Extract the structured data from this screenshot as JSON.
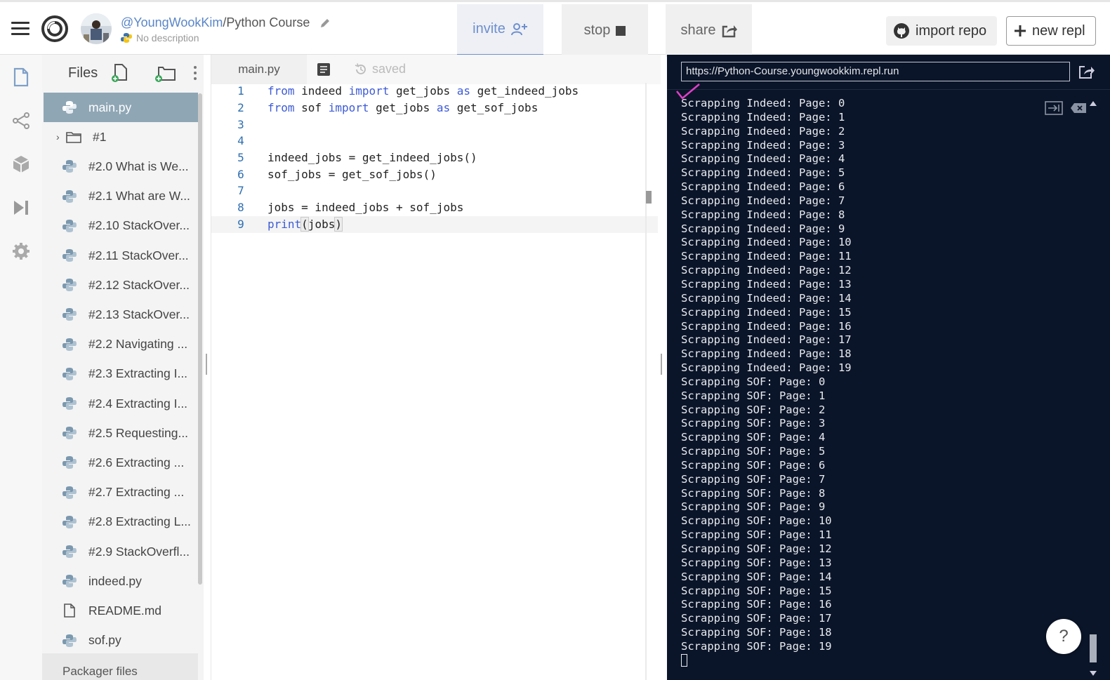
{
  "header": {
    "username": "@YoungWookKim",
    "separator": "/",
    "repl_name": "Python Course",
    "description": "No description",
    "invite_label": "invite",
    "stop_label": "stop",
    "share_label": "share",
    "import_label": "import repo",
    "new_repl_label": "new repl"
  },
  "files": {
    "title": "Files",
    "items": [
      {
        "label": "main.py",
        "type": "python",
        "active": true
      },
      {
        "label": "#1",
        "type": "folder"
      },
      {
        "label": "#2.0 What is We...",
        "type": "python"
      },
      {
        "label": "#2.1 What are W...",
        "type": "python"
      },
      {
        "label": "#2.10 StackOver...",
        "type": "python"
      },
      {
        "label": "#2.11 StackOver...",
        "type": "python"
      },
      {
        "label": "#2.12 StackOver...",
        "type": "python"
      },
      {
        "label": "#2.13 StackOver...",
        "type": "python"
      },
      {
        "label": "#2.2 Navigating ...",
        "type": "python"
      },
      {
        "label": "#2.3 Extracting I...",
        "type": "python"
      },
      {
        "label": "#2.4 Extracting I...",
        "type": "python"
      },
      {
        "label": "#2.5 Requesting...",
        "type": "python"
      },
      {
        "label": "#2.6 Extracting ...",
        "type": "python"
      },
      {
        "label": "#2.7 Extracting ...",
        "type": "python"
      },
      {
        "label": "#2.8 Extracting L...",
        "type": "python"
      },
      {
        "label": "#2.9 StackOverfl...",
        "type": "python"
      },
      {
        "label": "indeed.py",
        "type": "python"
      },
      {
        "label": "README.md",
        "type": "doc"
      },
      {
        "label": "sof.py",
        "type": "python"
      }
    ],
    "packager_label": "Packager files"
  },
  "editor": {
    "tab_label": "main.py",
    "saved_label": "saved",
    "lines": [
      {
        "n": "1",
        "tokens": [
          [
            "kw",
            "from"
          ],
          [
            "t",
            " indeed "
          ],
          [
            "kw",
            "import"
          ],
          [
            "t",
            " get_jobs "
          ],
          [
            "kw",
            "as"
          ],
          [
            "t",
            " get_indeed_jobs"
          ]
        ]
      },
      {
        "n": "2",
        "tokens": [
          [
            "kw",
            "from"
          ],
          [
            "t",
            " sof "
          ],
          [
            "kw",
            "import"
          ],
          [
            "t",
            " get_jobs "
          ],
          [
            "kw",
            "as"
          ],
          [
            "t",
            " get_sof_jobs"
          ]
        ]
      },
      {
        "n": "3",
        "tokens": []
      },
      {
        "n": "4",
        "tokens": []
      },
      {
        "n": "5",
        "tokens": [
          [
            "t",
            "indeed_jobs = get_indeed_jobs()"
          ]
        ]
      },
      {
        "n": "6",
        "tokens": [
          [
            "t",
            "sof_jobs = get_sof_jobs()"
          ]
        ]
      },
      {
        "n": "7",
        "tokens": []
      },
      {
        "n": "8",
        "tokens": [
          [
            "t",
            "jobs = indeed_jobs + sof_jobs"
          ]
        ]
      },
      {
        "n": "9",
        "tokens": [
          [
            "fn",
            "print"
          ],
          [
            "hl",
            "("
          ],
          [
            "t",
            "jobs"
          ],
          [
            "hl",
            ")"
          ]
        ],
        "current": true
      }
    ]
  },
  "console": {
    "url": "https://Python-Course.youngwookkim.repl.run",
    "output": [
      "Scrapping Indeed: Page: 0",
      "Scrapping Indeed: Page: 1",
      "Scrapping Indeed: Page: 2",
      "Scrapping Indeed: Page: 3",
      "Scrapping Indeed: Page: 4",
      "Scrapping Indeed: Page: 5",
      "Scrapping Indeed: Page: 6",
      "Scrapping Indeed: Page: 7",
      "Scrapping Indeed: Page: 8",
      "Scrapping Indeed: Page: 9",
      "Scrapping Indeed: Page: 10",
      "Scrapping Indeed: Page: 11",
      "Scrapping Indeed: Page: 12",
      "Scrapping Indeed: Page: 13",
      "Scrapping Indeed: Page: 14",
      "Scrapping Indeed: Page: 15",
      "Scrapping Indeed: Page: 16",
      "Scrapping Indeed: Page: 17",
      "Scrapping Indeed: Page: 18",
      "Scrapping Indeed: Page: 19",
      "Scrapping SOF: Page: 0",
      "Scrapping SOF: Page: 1",
      "Scrapping SOF: Page: 2",
      "Scrapping SOF: Page: 3",
      "Scrapping SOF: Page: 4",
      "Scrapping SOF: Page: 5",
      "Scrapping SOF: Page: 6",
      "Scrapping SOF: Page: 7",
      "Scrapping SOF: Page: 8",
      "Scrapping SOF: Page: 9",
      "Scrapping SOF: Page: 10",
      "Scrapping SOF: Page: 11",
      "Scrapping SOF: Page: 12",
      "Scrapping SOF: Page: 13",
      "Scrapping SOF: Page: 14",
      "Scrapping SOF: Page: 15",
      "Scrapping SOF: Page: 16",
      "Scrapping SOF: Page: 17",
      "Scrapping SOF: Page: 18",
      "Scrapping SOF: Page: 19"
    ],
    "help_label": "?"
  },
  "colors": {
    "accent": "#6e8fce",
    "console_bg": "#0b1529",
    "active_file": "#8fa6b5",
    "keyword": "#3d5bd6",
    "checkmark": "#e040c8"
  },
  "icons": {
    "rail": [
      "files-icon",
      "share-connections-icon",
      "packages-icon",
      "debugger-icon",
      "settings-icon"
    ]
  }
}
